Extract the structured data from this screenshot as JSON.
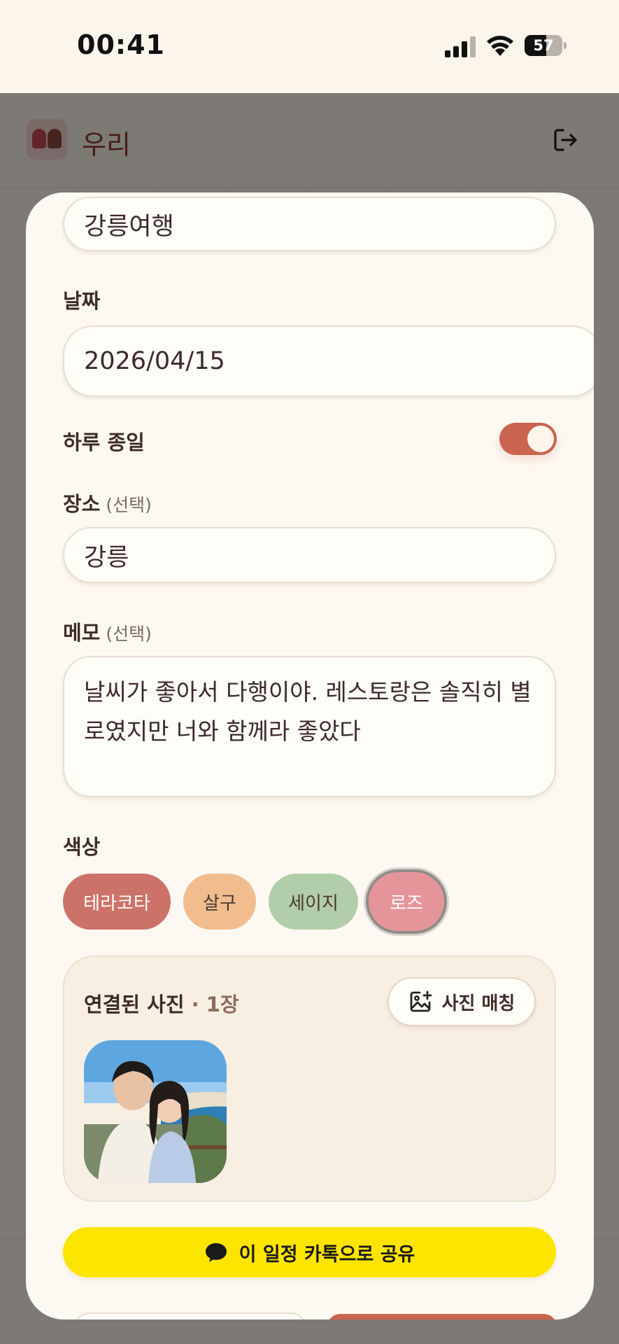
{
  "status_bar": {
    "time": "00:41",
    "battery_level": "57",
    "battery_fraction": 0.57
  },
  "app_header": {
    "title": "우리"
  },
  "form": {
    "title_value": "강릉여행",
    "date_label": "날짜",
    "date_value": "2026/04/15",
    "all_day_label": "하루 종일",
    "all_day_on": true,
    "location_label": "장소",
    "location_optional": "(선택)",
    "location_value": "강릉",
    "memo_label": "메모",
    "memo_optional": "(선택)",
    "memo_value": "날씨가 좋아서 다행이야. 레스토랑은 솔직히 별로였지만 너와 함께라 좋았다",
    "color_label": "색상",
    "colors": [
      {
        "label": "테라코타",
        "hex": "#cc7268"
      },
      {
        "label": "살구",
        "hex": "#f1bd8f"
      },
      {
        "label": "세이지",
        "hex": "#b2cda9"
      },
      {
        "label": "로즈",
        "hex": "#e5959a",
        "selected": true
      }
    ]
  },
  "photos": {
    "title": "연결된 사진",
    "count": "· 1장",
    "match_button": "사진 매칭"
  },
  "share_button": "이 일정 카톡으로 공유",
  "icons": [
    "logout-icon",
    "add-photo-icon",
    "chat-bubble-icon",
    "signal-icon",
    "wifi-icon",
    "battery-icon"
  ]
}
